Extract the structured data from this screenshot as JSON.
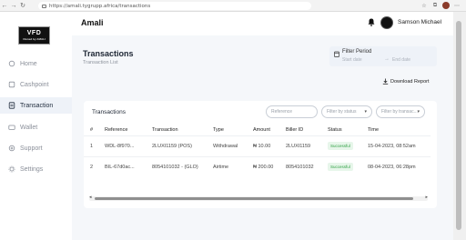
{
  "browser": {
    "url": "https://amali.tygrupp.africa/transactions",
    "back": "←",
    "forward": "→",
    "refresh": "↻"
  },
  "sidebar": {
    "logo_text": "VFD",
    "logo_sub": "Owned by AMALI",
    "items": [
      {
        "label": "Home",
        "icon": "home-icon"
      },
      {
        "label": "Cashpoint",
        "icon": "cashpoint-icon"
      },
      {
        "label": "Transaction",
        "icon": "transaction-icon",
        "active": true
      },
      {
        "label": "Wallet",
        "icon": "wallet-icon"
      },
      {
        "label": "Support",
        "icon": "support-icon"
      },
      {
        "label": "Settings",
        "icon": "settings-icon"
      }
    ]
  },
  "header": {
    "app_title": "Amali",
    "user_name": "Samson Michael"
  },
  "page": {
    "title": "Transactions",
    "subtitle": "Transaction List",
    "filter": {
      "label": "Filter Period",
      "start_placeholder": "Start date",
      "arrow": "→",
      "end_placeholder": "End date"
    },
    "download_label": "Download Report"
  },
  "card": {
    "title": "Transactions",
    "reference_placeholder": "Reference",
    "status_filter": "Filter by status",
    "transaction_filter": "Filter by transac...",
    "columns": [
      "#",
      "Reference",
      "Transaction",
      "Type",
      "Amount",
      "Biller ID",
      "Status",
      "Time"
    ],
    "rows": [
      [
        "1",
        "WDL-8f970...",
        "2LUXI1159 (POS)",
        "Withdrawal",
        "₦ 10.00",
        "2LUXI1159",
        "Successful",
        "15-04-2023, 08:52am"
      ],
      [
        "2",
        "BIL-67d0ac...",
        "8054101032 - (GLO)",
        "Airtime",
        "₦ 200.00",
        "8054101032",
        "Successful",
        "08-04-2023, 06:28pm"
      ]
    ]
  },
  "colors": {
    "accent": "#1f2b3c",
    "success_bg": "#e7f6ea",
    "success_text": "#2ea043",
    "active_nav_bg": "#eef2f8"
  }
}
